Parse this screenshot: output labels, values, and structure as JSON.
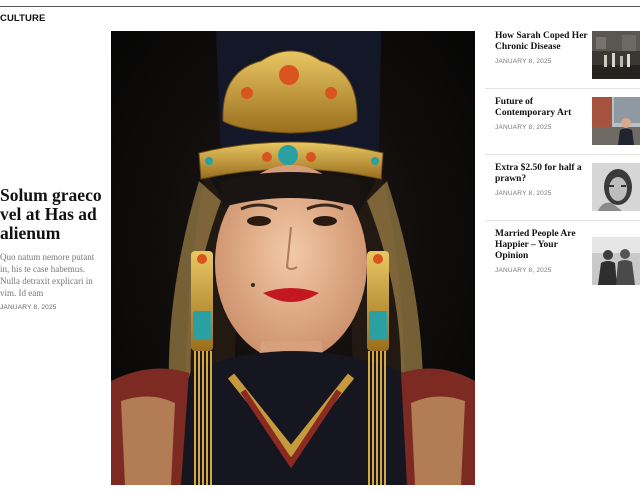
{
  "header": {
    "section": "CULTURE"
  },
  "feature": {
    "title": "Solum graeco vel at Has ad alienum",
    "excerpt": "Quo natum nemore putant in, his te case habemus. Nulla detraxit explicari in vim. Id eam",
    "date": "JANUARY 8, 2025"
  },
  "stories": [
    {
      "title": "How Sarah Coped Her Chronic Disease",
      "date": "JANUARY 8, 2025",
      "thumb_icon": "street-scene-photo"
    },
    {
      "title": "Future of Contemporary Art",
      "date": "JANUARY 8, 2025",
      "thumb_icon": "city-man-photo"
    },
    {
      "title": "Extra $2.50 for half a prawn?",
      "date": "JANUARY 8, 2025",
      "thumb_icon": "woman-portrait-bw-photo"
    },
    {
      "title": "Married People Are Happier – Your Opinion",
      "date": "JANUARY 8, 2025",
      "thumb_icon": "couple-bw-photo"
    }
  ],
  "colors": {
    "text": "#111111",
    "muted": "#777777",
    "divider": "#e3e3e3"
  }
}
